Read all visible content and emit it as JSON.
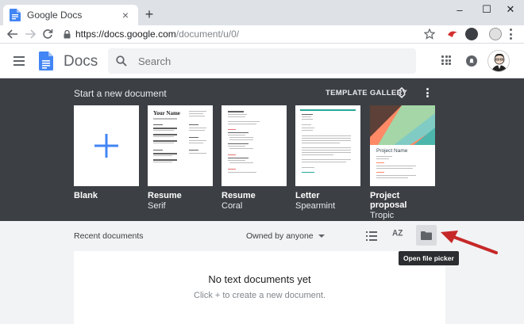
{
  "browser": {
    "tab_title": "Google Docs",
    "tab_close": "×",
    "new_tab": "+",
    "url_host": "https://docs.google.com",
    "url_path": "/document/u/0/",
    "window_controls": [
      "–",
      "☐",
      "✕"
    ]
  },
  "app": {
    "title": "Docs",
    "search_placeholder": "Search"
  },
  "gallery": {
    "title": "Start a new document",
    "template_gallery_label": "TEMPLATE GALLERY",
    "templates": [
      {
        "name": "Blank",
        "sub": ""
      },
      {
        "name": "Resume",
        "sub": "Serif"
      },
      {
        "name": "Resume",
        "sub": "Coral"
      },
      {
        "name": "Letter",
        "sub": "Spearmint"
      },
      {
        "name": "Project proposal",
        "sub": "Tropic"
      }
    ],
    "resume_serif_heading": "Your Name",
    "proposal_heading": "Project Name"
  },
  "recent": {
    "title": "Recent documents",
    "owner_filter": "Owned by anyone",
    "sort_label": "AZ",
    "tooltip": "Open file picker",
    "empty_title": "No text documents yet",
    "empty_sub": "Click + to create a new document."
  },
  "colors": {
    "docs_blue": "#4285f4",
    "gallery_bg": "#3c3f44",
    "arrow_red": "#c62828"
  }
}
